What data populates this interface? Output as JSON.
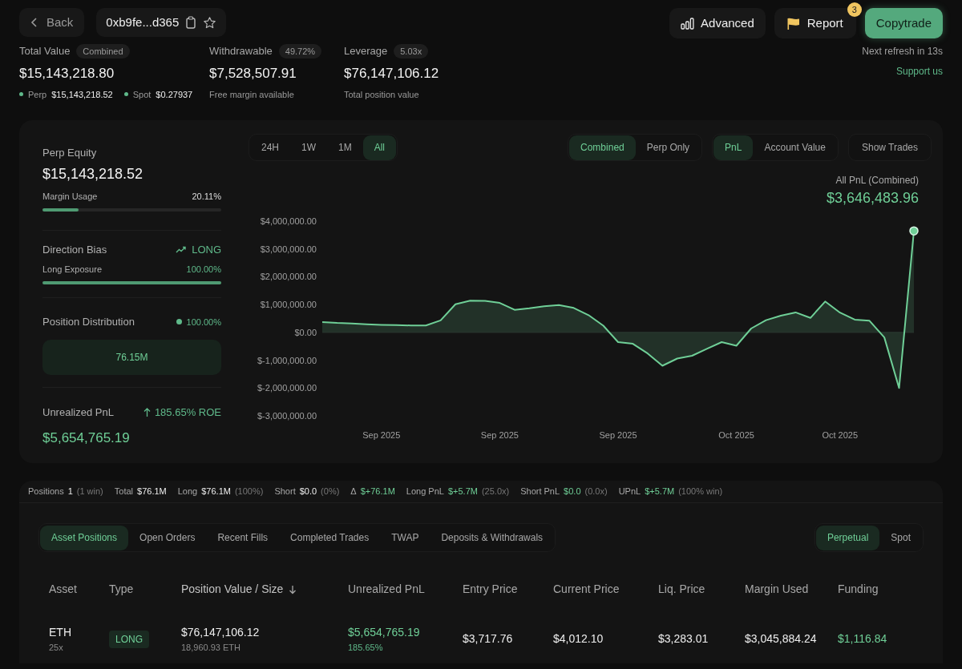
{
  "header": {
    "back_button": "Back",
    "address": "0xb9fe...d365",
    "advanced_button": "Advanced",
    "report_button": {
      "label": "Report",
      "badge": "3"
    },
    "copytrade_button": "Copytrade"
  },
  "stats": [
    {
      "kind": "total",
      "label": "Total Value",
      "badge": "Combined",
      "value": "$15,143,218.80",
      "breakdown": [
        {
          "label": "Perp",
          "value": "$15,143,218.52",
          "color": "#5fb98a"
        },
        {
          "label": "Spot",
          "value": "$0.27937",
          "color": "#5fb98a"
        }
      ]
    },
    {
      "kind": "plain",
      "label": "Withdrawable",
      "badge": "49.72%",
      "value": "$7,528,507.91",
      "note": "Free margin available"
    },
    {
      "kind": "plain",
      "label": "Leverage",
      "badge": "5.03x",
      "value": "$76,147,106.12",
      "note": "Total position value"
    }
  ],
  "refresh": {
    "text": "Next refresh in 13s",
    "support_link": "Support us"
  },
  "account": {
    "perp_equity": {
      "label": "Perp Equity",
      "value": "$15,143,218.52",
      "meter": {
        "label": "Margin Usage",
        "reading": "20.11%",
        "level": 0.2011
      }
    },
    "direction_bias": {
      "label": "Direction Bias",
      "value": "LONG",
      "meter": {
        "label": "Long Exposure",
        "reading": "100.00%",
        "level": 1
      }
    },
    "position_distribution": {
      "label": "Position Distribution",
      "reading": "100.00%",
      "bar_label": "76.15M"
    },
    "unrealized_pnl": {
      "label": "Unrealized PnL",
      "roe": "185.65% ROE",
      "value": "$5,654,765.19"
    }
  },
  "chart_panel": {
    "range_tabs": [
      {
        "label": "24H",
        "selected": false
      },
      {
        "label": "1W",
        "selected": false
      },
      {
        "label": "1M",
        "selected": false
      },
      {
        "label": "All",
        "selected": true
      }
    ],
    "mode_tabs": [
      {
        "label": "Combined",
        "selected": true
      },
      {
        "label": "Perp Only",
        "selected": false
      }
    ],
    "metric_tabs": [
      {
        "label": "PnL",
        "selected": true
      },
      {
        "label": "Account Value",
        "selected": false
      }
    ],
    "show_trades_button": "Show Trades",
    "summary": {
      "label": "All PnL (Combined)",
      "value": "$3,646,483.96"
    },
    "chart_data": {
      "type": "area",
      "categories": [
        null,
        null,
        null,
        null,
        "Sep 2025",
        null,
        null,
        null,
        null,
        null,
        null,
        null,
        "Sep 2025",
        null,
        null,
        null,
        null,
        null,
        null,
        null,
        "Sep 2025",
        null,
        null,
        null,
        null,
        null,
        null,
        null,
        "Oct 2025",
        null,
        null,
        null,
        null,
        null,
        null,
        "Oct 2025",
        null,
        null,
        null,
        null,
        null
      ],
      "series": [
        {
          "color": "#6fcf97",
          "values": [
            370000,
            340000,
            320000,
            290000,
            270000,
            260000,
            250000,
            250000,
            430000,
            1010000,
            1140000,
            1130000,
            1060000,
            810000,
            870000,
            940000,
            980000,
            880000,
            620000,
            240000,
            -350000,
            -410000,
            -760000,
            -1200000,
            -940000,
            -840000,
            -590000,
            -350000,
            -480000,
            140000,
            440000,
            600000,
            720000,
            520000,
            1110000,
            710000,
            460000,
            420000,
            -180000,
            -2000000,
            3650000
          ]
        }
      ],
      "ylim": [
        -3000000,
        4000000
      ],
      "yticks": [
        {
          "value": 4000000,
          "label": "$4,000,000.00"
        },
        {
          "value": 3000000,
          "label": "$3,000,000.00"
        },
        {
          "value": 2000000,
          "label": "$2,000,000.00"
        },
        {
          "value": 1000000,
          "label": "$1,000,000.00"
        },
        {
          "value": 0,
          "label": "$0.00"
        },
        {
          "value": -1000000,
          "label": "$-1,000,000.00"
        },
        {
          "value": -2000000,
          "label": "$-2,000,000.00"
        },
        {
          "value": -3000000,
          "label": "$-3,000,000.00"
        }
      ]
    }
  },
  "summary_bar": [
    {
      "label": "Positions",
      "value": "1",
      "note": "(1 win)",
      "positive": false
    },
    {
      "label": "Total",
      "value": "$76.1M",
      "positive": false
    },
    {
      "label": "Long",
      "value": "$76.1M",
      "note": "(100%)",
      "positive": false
    },
    {
      "label": "Short",
      "value": "$0.0",
      "note": "(0%)",
      "positive": false
    },
    {
      "label": "Δ",
      "value": "$+76.1M",
      "positive": true
    },
    {
      "label": "Long PnL",
      "value": "$+5.7M",
      "note": "(25.0x)",
      "positive": true
    },
    {
      "label": "Short PnL",
      "value": "$0.0",
      "note": "(0.0x)",
      "positive": true
    },
    {
      "label": "UPnL",
      "value": "$+5.7M",
      "note": "(100% win)",
      "positive": true
    }
  ],
  "tabs": [
    {
      "label": "Asset Positions",
      "selected": true
    },
    {
      "label": "Open Orders",
      "selected": false
    },
    {
      "label": "Recent Fills",
      "selected": false
    },
    {
      "label": "Completed Trades",
      "selected": false
    },
    {
      "label": "TWAP",
      "selected": false
    },
    {
      "label": "Deposits & Withdrawals",
      "selected": false
    }
  ],
  "market_tabs": [
    {
      "label": "Perpetual",
      "selected": true
    },
    {
      "label": "Spot",
      "selected": false
    }
  ],
  "table": {
    "columns": [
      {
        "label": "Asset",
        "sorted": false
      },
      {
        "label": "Type",
        "sorted": false
      },
      {
        "label": "Position Value / Size",
        "sorted": true
      },
      {
        "label": "Unrealized PnL",
        "sorted": false
      },
      {
        "label": "Entry Price",
        "sorted": false
      },
      {
        "label": "Current Price",
        "sorted": false
      },
      {
        "label": "Liq. Price",
        "sorted": false
      },
      {
        "label": "Margin Used",
        "sorted": false
      },
      {
        "label": "Funding",
        "sorted": false
      }
    ],
    "rows": [
      {
        "asset": "ETH",
        "leverage": "25x",
        "type": "LONG",
        "position_value": "$76,147,106.12",
        "size": "18,960.93 ETH",
        "unrealized_pnl": "$5,654,765.19",
        "pnl_percent": "185.65%",
        "entry_price": "$3,717.76",
        "current_price": "$4,012.10",
        "liq_price": "$3,283.01",
        "margin_used": "$3,045,884.24",
        "funding": "$1,116.84"
      }
    ]
  }
}
